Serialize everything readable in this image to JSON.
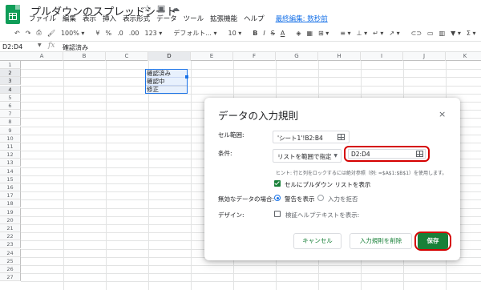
{
  "app": {
    "doc_title": "プルダウンのスプレッドシート",
    "menu": [
      "ファイル",
      "編集",
      "表示",
      "挿入",
      "表示形式",
      "データ",
      "ツール",
      "拡張機能",
      "ヘルプ"
    ],
    "last_edit": "最終編集: 数秒前"
  },
  "toolbar": {
    "zoom": "100%",
    "currency": "¥",
    "percent": "%",
    "dec_less": ".0",
    "dec_more": ".00",
    "number_format": "123",
    "font": "デフォルト...",
    "font_size": "10",
    "bold": "B",
    "italic": "I",
    "strike": "S",
    "text_color": "A"
  },
  "formula_bar": {
    "cell_ref": "D2:D4",
    "fx": "fx",
    "value": "確認済み"
  },
  "grid": {
    "columns": [
      "A",
      "B",
      "C",
      "D",
      "E",
      "F",
      "G",
      "H",
      "I",
      "J",
      "K"
    ],
    "rows": [
      "1",
      "2",
      "3",
      "4",
      "5",
      "6",
      "7",
      "8",
      "9",
      "10",
      "11",
      "12",
      "13",
      "14",
      "15",
      "16",
      "17",
      "18",
      "19",
      "20",
      "21",
      "22",
      "23",
      "24",
      "25",
      "26",
      "27"
    ],
    "cells": {
      "D2": "確認済み",
      "D3": "確認中",
      "D4": "修正"
    }
  },
  "dialog": {
    "title": "データの入力規則",
    "close": "×",
    "range_label": "セル範囲:",
    "range_value": "'シート1'!B2:B4",
    "criteria_label": "条件:",
    "criteria_select": "リストを範囲で指定",
    "criteria_range": "D2:D4",
    "hint": "ヒント: 行と列をロックするには絶対参照（例: =$A$1:$B$1）を使用します。",
    "show_dropdown_label": "セルにプルダウン リストを表示",
    "invalid_label": "無効なデータの場合:",
    "invalid_warn": "警告を表示",
    "invalid_reject": "入力を拒否",
    "design_label": "デザイン:",
    "help_text_label": "検証ヘルプテキストを表示:",
    "cancel": "キャンセル",
    "remove": "入力規則を削除",
    "save": "保存"
  }
}
